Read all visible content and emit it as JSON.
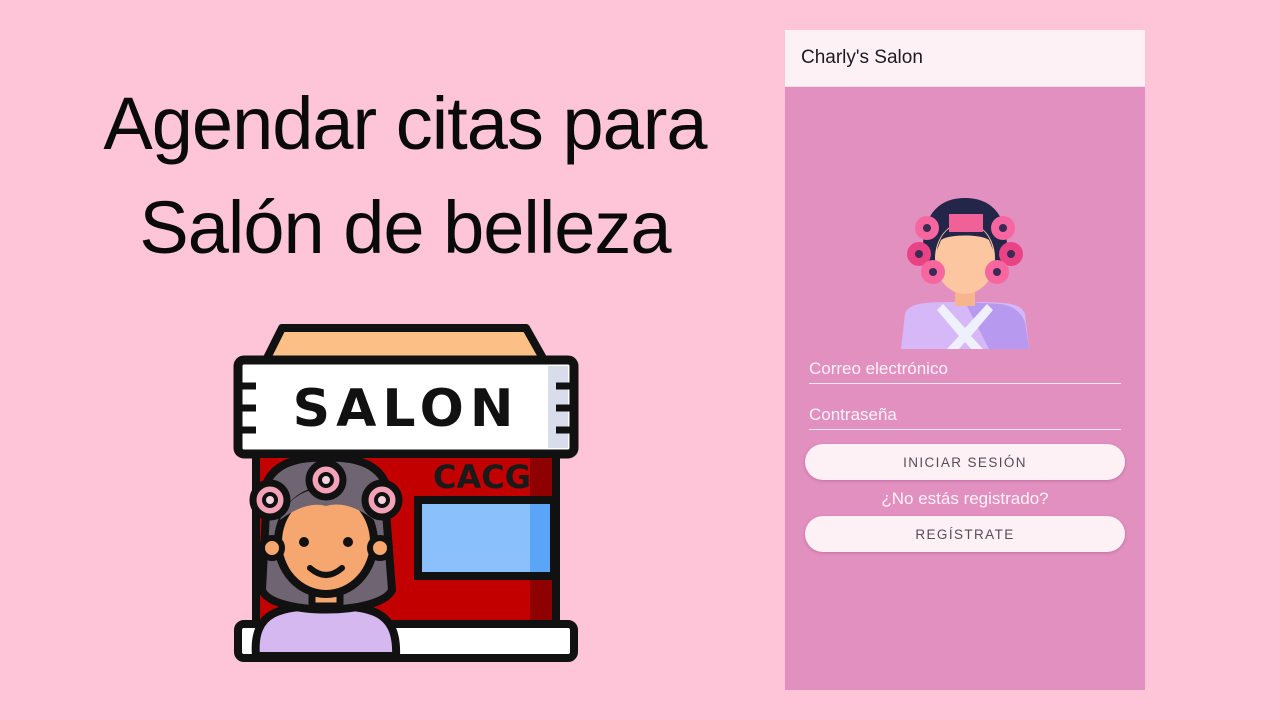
{
  "headline": {
    "line1": "Agendar citas para",
    "line2": "Salón de belleza"
  },
  "illustration": {
    "sign": "SALON",
    "store_sign": "CACG"
  },
  "app": {
    "title": "Charly's Salon",
    "email_label": "Correo electrónico",
    "password_label": "Contraseña",
    "login_button": "INICIAR SESIÓN",
    "not_registered": "¿No estás registrado?",
    "register_button": "REGÍSTRATE"
  },
  "colors": {
    "page_background": "#fec5d9",
    "app_background": "#e290c0",
    "app_bar": "#fdf1f5",
    "button": "#fdf1f5"
  },
  "icons": [
    "salon-storefront-icon",
    "woman-with-curlers-icon"
  ]
}
